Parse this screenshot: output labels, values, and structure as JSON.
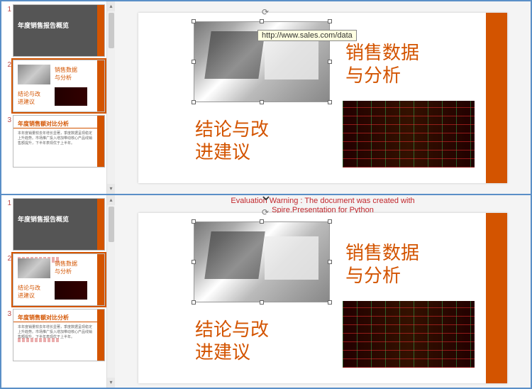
{
  "thumbnails": {
    "n1": "1",
    "n2": "2",
    "n3": "3",
    "slide1_title": "年度销售报告概览",
    "slide2_text1": "销售数据\n与分析",
    "slide2_text2": "结论与改\n进建议",
    "slide3_title": "年度销售额对比分析",
    "slide3_body": "本年度销量较去年增长显著，季度数据呈现稳定上升趋势。市场推广投入增加带动核心产品线销售额提升，下半年表现优于上半年。"
  },
  "slide": {
    "text1_line1": "销售数据",
    "text1_line2": "与分析",
    "text2_line1": "结论与改",
    "text2_line2": "进建议",
    "hyperlink_tooltip": "http://www.sales.com/data"
  },
  "bottom": {
    "eval_warning_l1": "Evaluation Warning : The document was created with",
    "eval_warning_l2": "Spire.Presentation for Python"
  },
  "icons": {
    "rotate": "⟳",
    "up": "▴",
    "down": "▾",
    "divider": "⌄"
  }
}
